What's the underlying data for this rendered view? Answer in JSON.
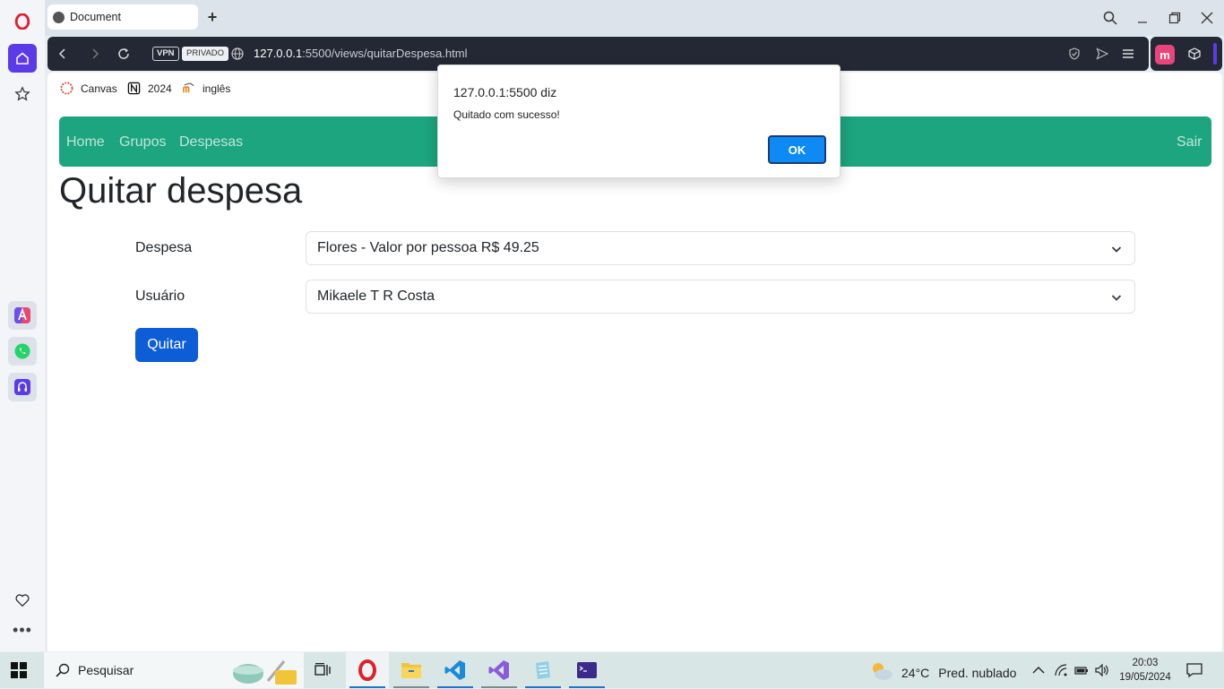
{
  "browser": {
    "tab_title": "Document",
    "vpn_label": "VPN",
    "private_label": "PRIVADO",
    "url_host": "127.0.0.1",
    "url_rest": ":5500/views/quitarDespesa.html",
    "bookmarks": [
      "Canvas",
      "2024",
      "inglês"
    ]
  },
  "navbar": {
    "links": [
      "Home",
      "Grupos",
      "Despesas"
    ],
    "logout": "Sair",
    "color": "#1ca57e"
  },
  "page": {
    "title": "Quitar despesa",
    "despesa_label": "Despesa",
    "despesa_value": "Flores - Valor por pessoa R$ 49.25",
    "usuario_label": "Usuário",
    "usuario_value": "Mikaele T R Costa",
    "submit_label": "Quitar"
  },
  "dialog": {
    "title": "127.0.0.1:5500 diz",
    "message": "Quitado com sucesso!",
    "ok_label": "OK"
  },
  "taskbar": {
    "search_placeholder": "Pesquisar",
    "weather_temp": "24°C",
    "weather_desc": "Pred. nublado",
    "time": "20:03",
    "date": "19/05/2024"
  }
}
